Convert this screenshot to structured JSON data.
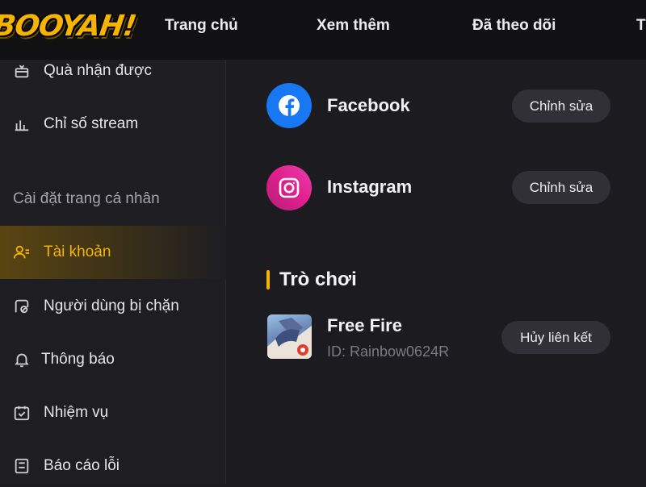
{
  "brand": {
    "logo_text": "BOOYAH!",
    "accent": "#f7b500"
  },
  "nav": {
    "items": [
      {
        "label": "Trang chủ"
      },
      {
        "label": "Xem thêm"
      },
      {
        "label": "Đã theo dõi"
      },
      {
        "label": "T"
      }
    ]
  },
  "sidebar": {
    "items": [
      {
        "label": "Quà nhận được",
        "icon": "gift-icon"
      },
      {
        "label": "Chỉ số stream",
        "icon": "bar-chart-icon"
      }
    ],
    "section_label": "Cài đặt trang cá nhân",
    "settings_items": [
      {
        "label": "Tài khoản",
        "icon": "user-settings-icon",
        "active": true
      },
      {
        "label": "Người dùng bị chặn",
        "icon": "blocked-user-icon"
      },
      {
        "label": "Thông báo",
        "icon": "bell-icon"
      },
      {
        "label": "Nhiệm vụ",
        "icon": "calendar-check-icon"
      },
      {
        "label": "Báo cáo lỗi",
        "icon": "report-icon"
      }
    ]
  },
  "main": {
    "linked_accounts": [
      {
        "name": "Facebook",
        "icon": "facebook-icon",
        "color": "#1877f2",
        "action": "Chỉnh sửa"
      },
      {
        "name": "Instagram",
        "icon": "instagram-icon",
        "color": "#e01e8c",
        "action": "Chỉnh sửa"
      }
    ],
    "games_section": {
      "title": "Trò chơi",
      "games": [
        {
          "name": "Free Fire",
          "id_text": "ID: Rainbow0624R",
          "action": "Hủy liên kết",
          "icon": "free-fire-icon"
        }
      ]
    }
  }
}
